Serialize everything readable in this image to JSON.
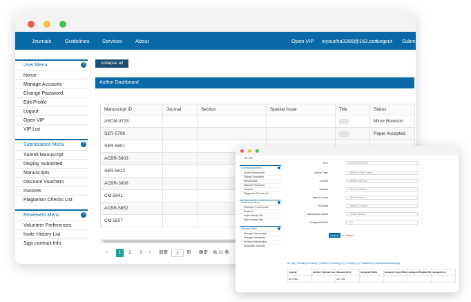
{
  "nav": {
    "items": [
      "Journals",
      "Guidelines",
      "Services",
      "About"
    ],
    "open_vip": "Open VIP",
    "user_email": "xiyoucha3366@163.com",
    "logout": "Logout",
    "submit": "Submit"
  },
  "menus": [
    {
      "title": "User Menu",
      "items": [
        "Home",
        "Manage Accounts",
        "Change Password",
        "Edit Profile",
        "Logout",
        "Open VIP",
        "VIP List"
      ]
    },
    {
      "title": "Submissions Menu",
      "items": [
        "Submit Manuscript",
        "Display Submitted",
        "Manuscripts",
        "Discount Vouchers",
        "Invoices",
        "Plagiarism Checks List"
      ]
    },
    {
      "title": "Reviewers Menu",
      "items": [
        "Volunteer Preferences",
        "Invite History List",
        "Sign contract Info"
      ]
    }
  ],
  "collapse_label": "collapse all",
  "dashboard_title": "Author Dashboard",
  "table": {
    "headers": [
      "Manuscript ID",
      "Journal",
      "Section",
      "Special Issue",
      "Title",
      "Status"
    ],
    "rows": [
      [
        "AECM-3778",
        "",
        "",
        "",
        "",
        "Minor Revision"
      ],
      [
        "SER-5798",
        "",
        "",
        "",
        "",
        "Paper Accepted"
      ],
      [
        "SER-5801",
        "",
        "",
        "",
        "",
        ""
      ],
      [
        "ACBR-5803",
        "",
        "",
        "",
        "",
        ""
      ],
      [
        "SER-5812",
        "",
        "",
        "",
        "",
        ""
      ],
      [
        "ACBR-3808",
        "",
        "",
        "",
        "",
        ""
      ],
      [
        "CM-5841",
        "",
        "",
        "",
        "",
        ""
      ],
      [
        "ACBR-5852",
        "",
        "",
        "",
        "",
        ""
      ],
      [
        "CM-5857",
        "",
        "",
        "",
        "",
        ""
      ]
    ]
  },
  "pager": {
    "prev": "‹",
    "pages": [
      "1",
      "2",
      "3"
    ],
    "next": "›",
    "goto": "到第",
    "current": "1",
    "page_unit": "页",
    "confirm": "确定",
    "total": "共 21 条"
  },
  "second_window": {
    "side_menus": [
      {
        "title": "Submissions Menu",
        "items": [
          "Submit Manuscript",
          "Display Submitted",
          "Manuscripts",
          "Discount Vouchers",
          "Invoices",
          "Plagiarism Checks List"
        ]
      },
      {
        "title": "Reviewers Menu",
        "items": [
          "Volunteer Preferences",
          "Reviews",
          "Invite History List",
          "Sign contract Info"
        ]
      },
      {
        "title": "Editorial Office",
        "items": [
          "Manage Manuscripts",
          "Manage Volunteers",
          "Process Manuscripts",
          "Subscribe Journals"
        ]
      }
    ],
    "side_top": "VIP List",
    "form": [
      {
        "label": "DOI",
        "placeholder": "10.XXXX/XXXXX"
      },
      {
        "label": "Article Type",
        "placeholder": "--Select Article Types--"
      },
      {
        "label": "Journal",
        "placeholder": "--Select Journal--"
      },
      {
        "label": "Section",
        "placeholder": "--Select Section--"
      },
      {
        "label": "Special Issue",
        "placeholder": "--Select Issue--"
      },
      {
        "label": "SI Editor",
        "placeholder": "--Select SI Editor--"
      },
      {
        "label": "Manuscript Status",
        "placeholder": "--Select status--"
      },
      {
        "label": "Assigned Editor",
        "placeholder": "--All--"
      }
    ],
    "search_label": "Search",
    "or_label": "or",
    "reset_label": "Reset",
    "filters": "All (16) | Pending Review(1) | Under Processing (2) | Proofing (1) | Published(1) Rejected/withdrawn(8)",
    "table_headers": [
      "Journal",
      "Section / Special Issue",
      "Manuscript ID",
      "Assigned Editor",
      "Assigned Copy Editor",
      "Assigned English Editor",
      "Assigned La"
    ],
    "table_row": [
      "ACT-3811",
      "",
      "ACT info",
      "",
      "",
      "",
      ""
    ]
  }
}
